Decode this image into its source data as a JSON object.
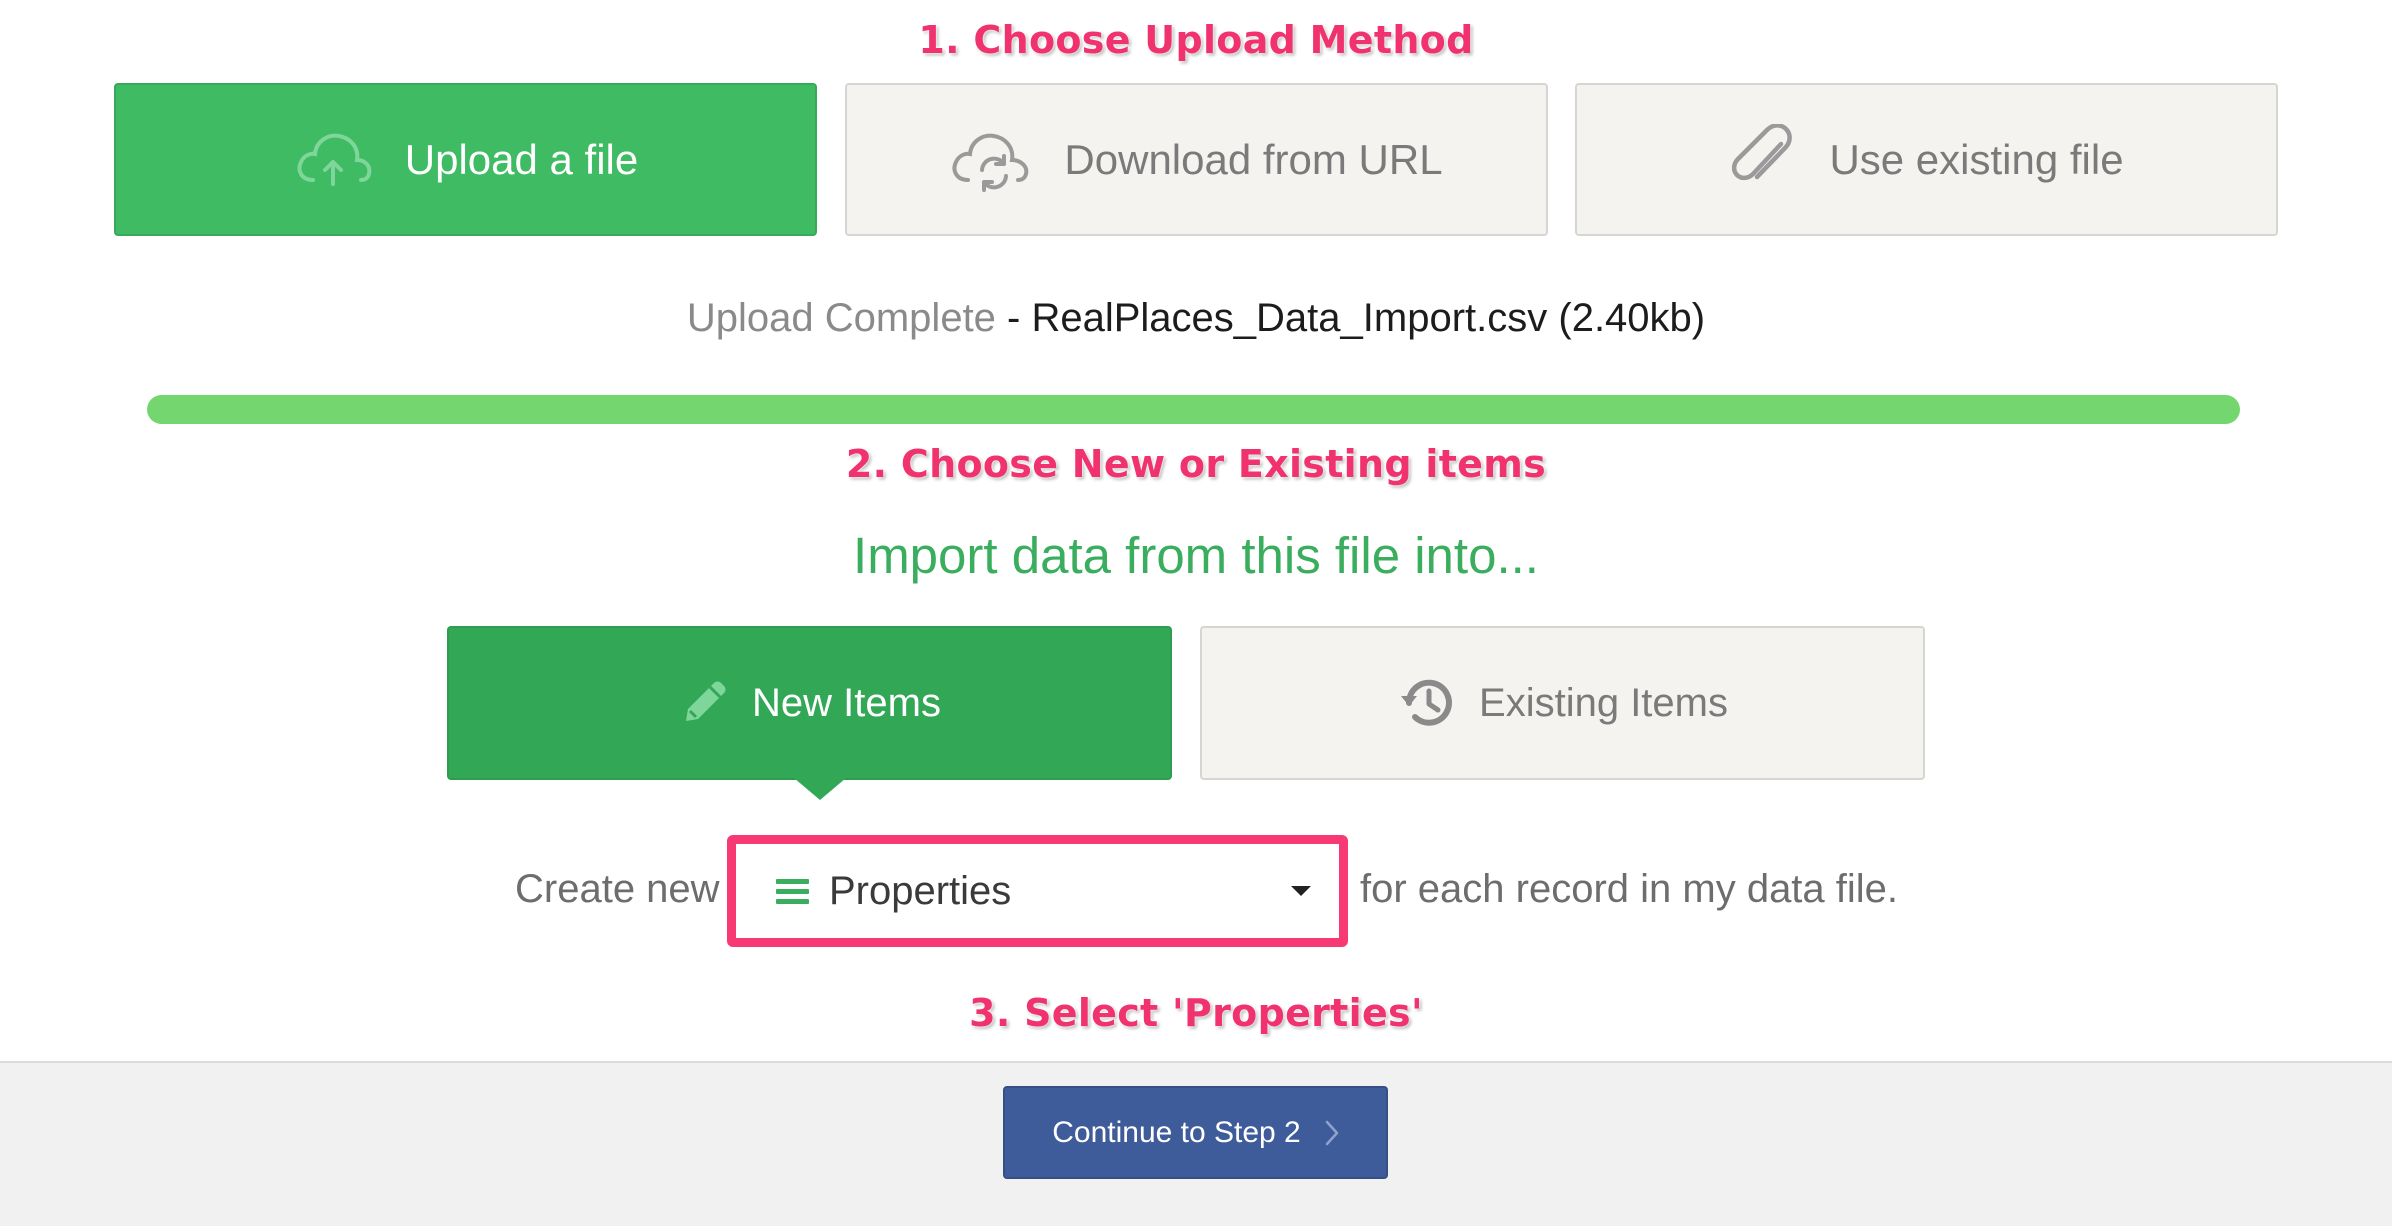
{
  "annotations": {
    "step1": "1. Choose Upload Method",
    "step2": "2. Choose New or Existing items",
    "step3": "3. Select 'Properties'"
  },
  "upload_methods": [
    {
      "label": "Upload a file",
      "icon": "cloud-upload-icon",
      "active": true
    },
    {
      "label": "Download from URL",
      "icon": "cloud-sync-icon",
      "active": false
    },
    {
      "label": "Use existing file",
      "icon": "paperclip-icon",
      "active": false
    }
  ],
  "upload_status": {
    "status": "Upload Complete",
    "separator": " - ",
    "filename": "RealPlaces_Data_Import.csv",
    "size": "(2.40kb)",
    "progress_percent": 100
  },
  "import": {
    "title": "Import data from this file into...",
    "options": [
      {
        "label": "New Items",
        "icon": "pencil-icon",
        "active": true
      },
      {
        "label": "Existing Items",
        "icon": "history-icon",
        "active": false
      }
    ],
    "create_label": "Create new",
    "selected_type": "Properties",
    "after_label": "for each record in my data file."
  },
  "footer": {
    "continue_label": "Continue to Step 2"
  },
  "colors": {
    "annotation": "#f0336f",
    "green_light": "#3fbb63",
    "green_dark": "#32a857",
    "progress": "#74d66e",
    "highlight_border": "#f73a74",
    "continue_button": "#3f5c9a"
  }
}
